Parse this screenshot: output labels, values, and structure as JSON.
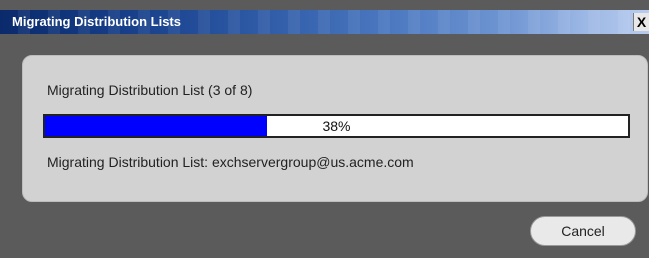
{
  "window": {
    "title": "Migrating Distribution Lists",
    "close_label": "X"
  },
  "progress_panel": {
    "status_text": "Migrating Distribution List (3 of 8)",
    "progress_percent": 38,
    "progress_label": "38%",
    "current_item_text": "Migrating Distribution List: exchservergroup@us.acme.com"
  },
  "actions": {
    "cancel_label": "Cancel"
  },
  "colors": {
    "progress_fill": "#0000ff",
    "panel_bg": "#d2d2d2",
    "window_bg": "#5b5b5b"
  }
}
